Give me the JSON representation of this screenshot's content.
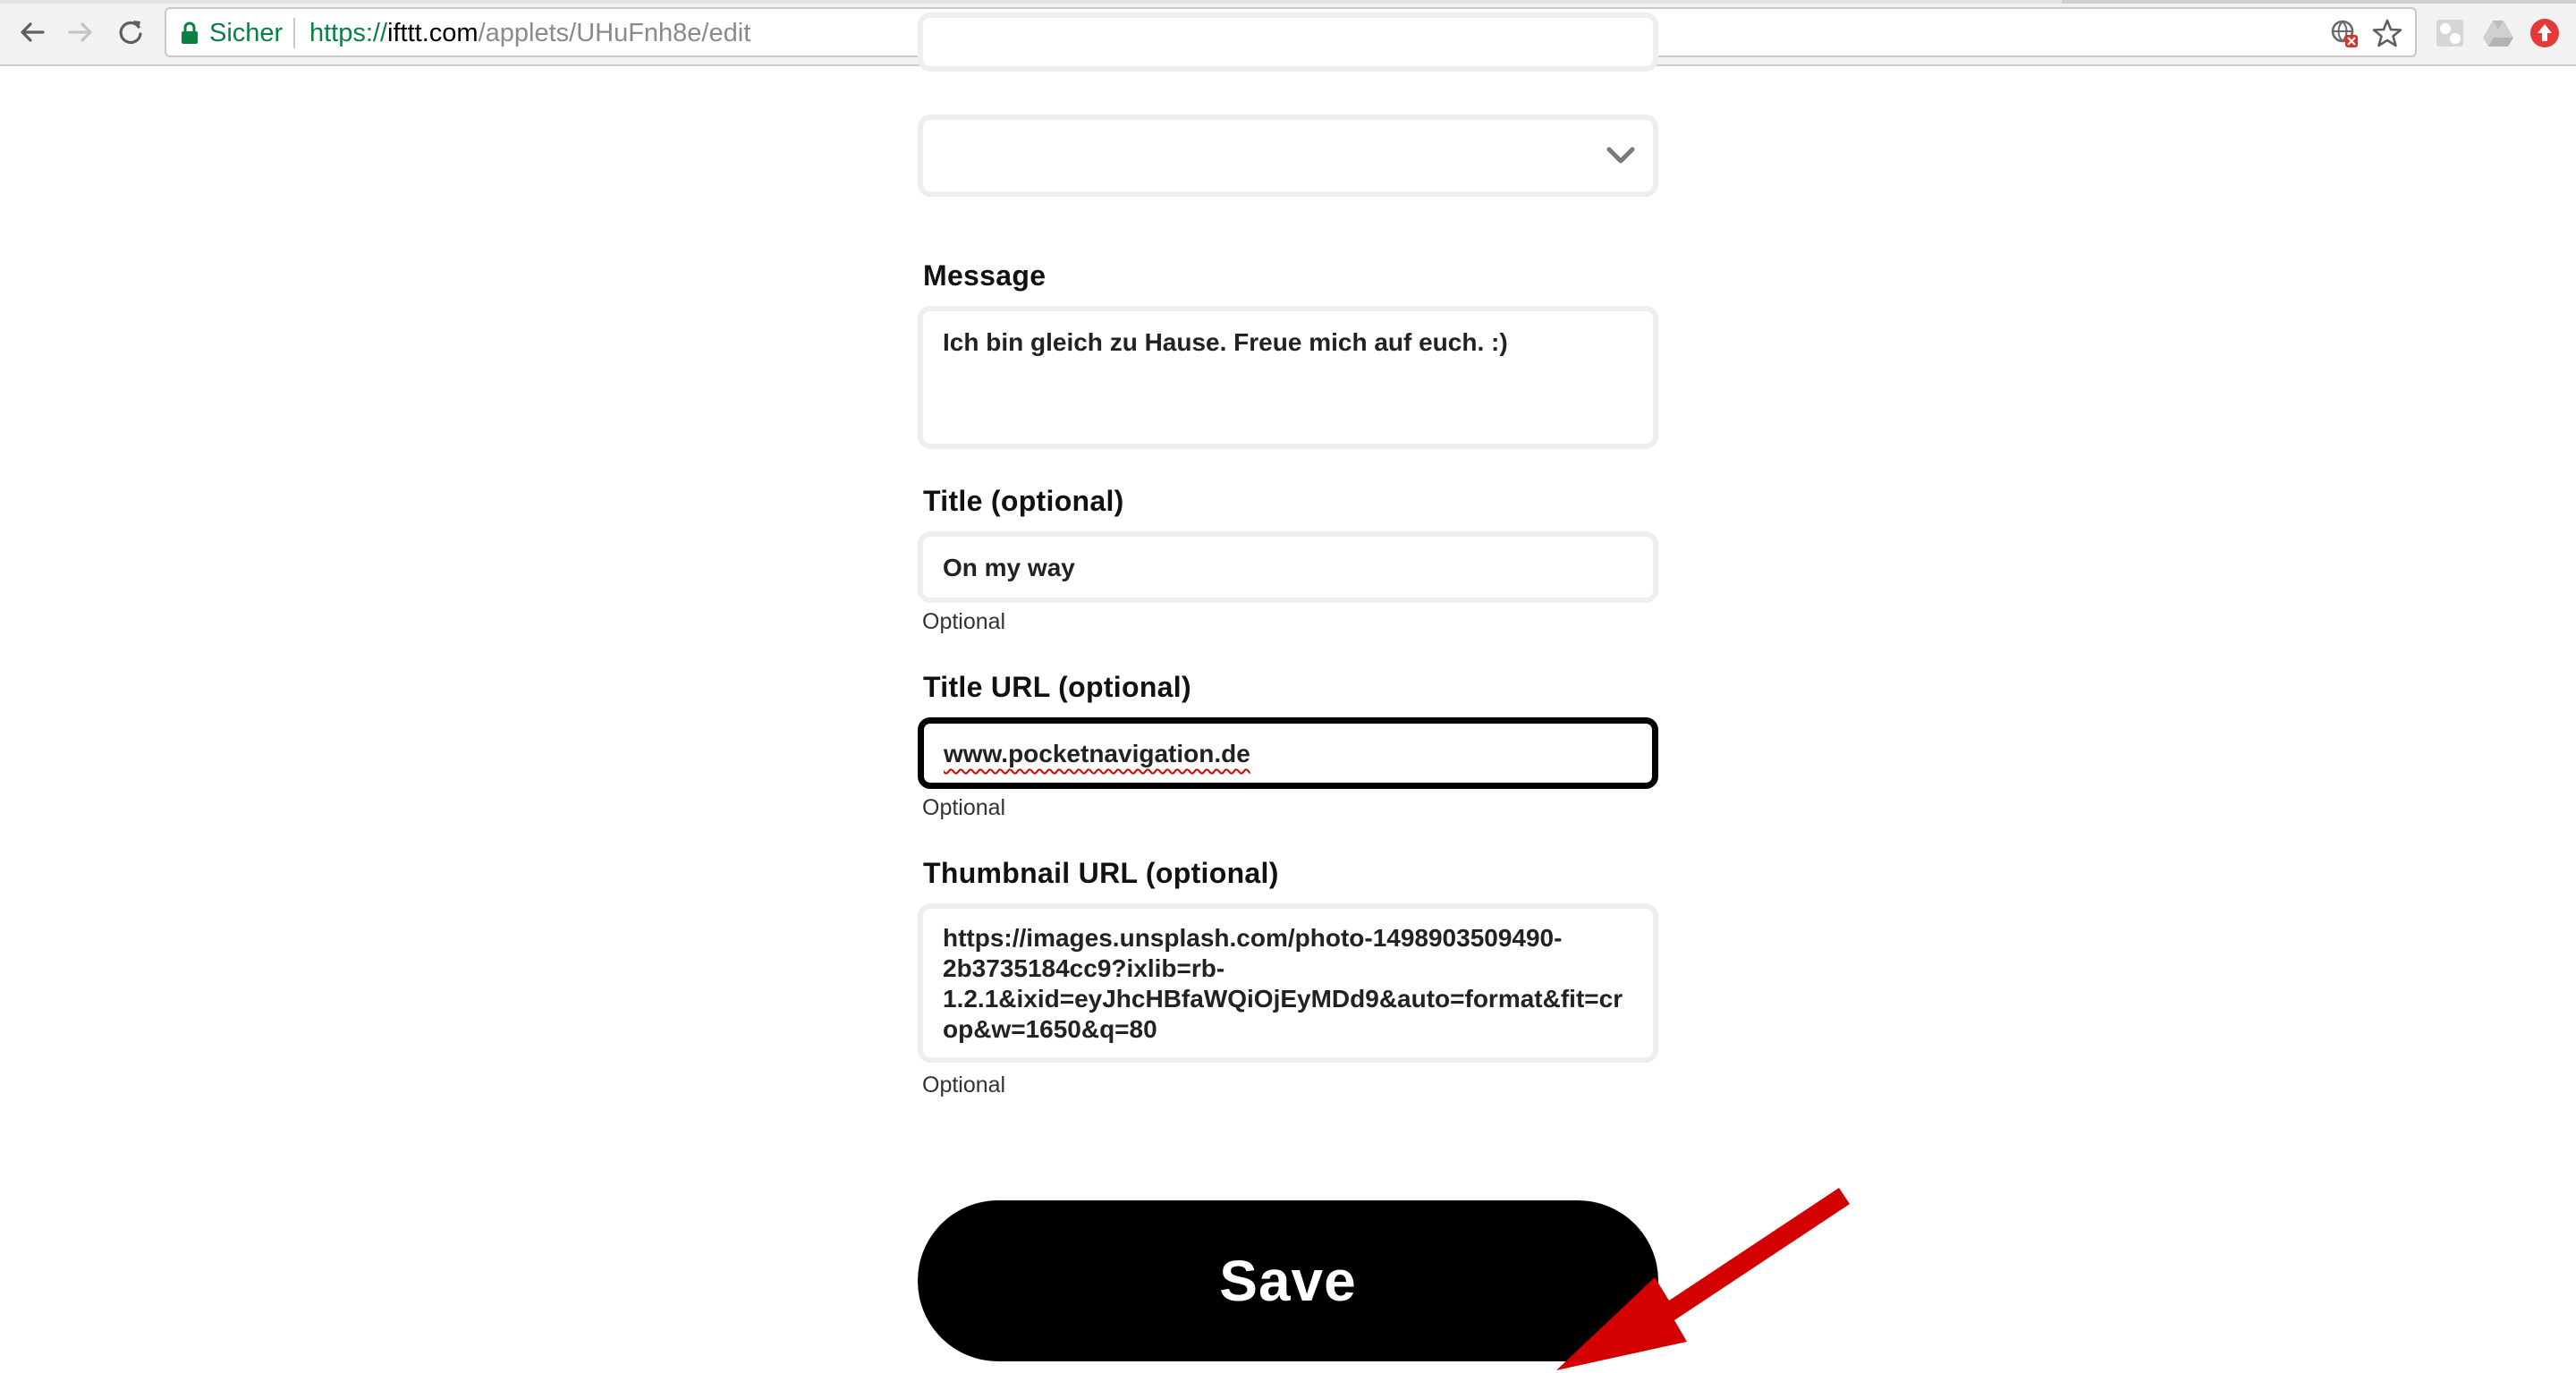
{
  "browser": {
    "secure_label": "Sicher",
    "url": {
      "scheme": "https://",
      "host": "ifttt.com",
      "path": "/applets/UHuFnh8e/edit"
    },
    "icons": {
      "back": "back-arrow-icon",
      "forward": "forward-arrow-icon",
      "reload": "reload-icon",
      "lock": "lock-icon",
      "translate": "translate-icon",
      "bookmark": "star-icon",
      "extensions": [
        "puzzle-extension-icon",
        "drive-extension-icon",
        "record-extension-icon"
      ]
    }
  },
  "form": {
    "select": {
      "value": "",
      "icon": "chevron-down-icon"
    },
    "message": {
      "label": "Message",
      "value": "Ich bin gleich zu Hause. Freue mich auf euch. :)"
    },
    "title": {
      "label": "Title (optional)",
      "value": "On my way",
      "helper": "Optional"
    },
    "title_url": {
      "label": "Title URL (optional)",
      "value": "www.pocketnavigation.de",
      "helper": "Optional"
    },
    "thumbnail_url": {
      "label": "Thumbnail URL (optional)",
      "lines": [
        "https://images.unsplash.com/photo-1498903509490-",
        "2b3735184cc9?ixlib=rb-",
        "1.2.1&ixid=eyJhcHBfaWQiOjEyMDd9&auto=format&fit=cr",
        "op&w=1650&q=80"
      ],
      "helper": "Optional"
    },
    "save_label": "Save"
  },
  "colors": {
    "secure_green": "#0b8043",
    "button_black": "#000000",
    "annotation_red": "#d40000",
    "field_border": "#eeeeee"
  }
}
